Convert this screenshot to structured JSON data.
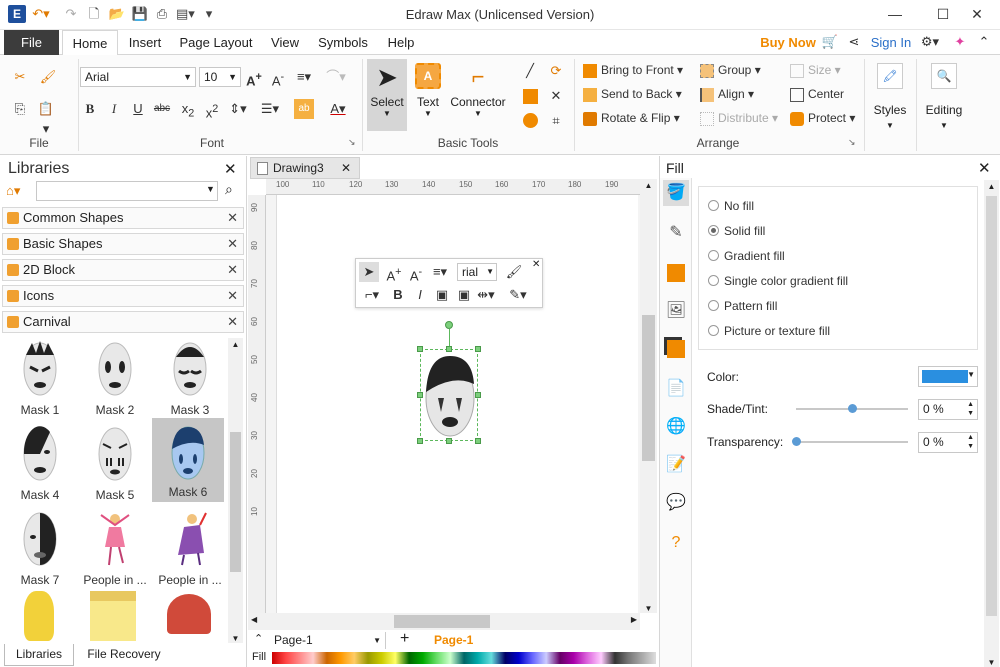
{
  "window": {
    "title": "Edraw Max (Unlicensed Version)"
  },
  "menu": {
    "file": "File",
    "tabs": [
      "Home",
      "Insert",
      "Page Layout",
      "View",
      "Symbols",
      "Help"
    ],
    "buy_now": "Buy Now",
    "sign_in": "Sign In"
  },
  "ribbon": {
    "groups": {
      "file": "File",
      "font": "Font",
      "basic_tools": "Basic Tools",
      "arrange": "Arrange"
    },
    "font_name": "Arial",
    "font_size": "10",
    "tools": {
      "select": "Select",
      "text": "Text",
      "connector": "Connector"
    },
    "arrange": {
      "bring_to_front": "Bring to Front",
      "send_to_back": "Send to Back",
      "rotate_flip": "Rotate & Flip",
      "group": "Group",
      "align": "Align",
      "distribute": "Distribute",
      "size": "Size",
      "center": "Center",
      "protect": "Protect"
    },
    "styles": "Styles",
    "editing": "Editing"
  },
  "libraries": {
    "title": "Libraries",
    "search_placeholder": "",
    "items": [
      "Common Shapes",
      "Basic Shapes",
      "2D Block",
      "Icons",
      "Carnival"
    ],
    "shapes": [
      "Mask 1",
      "Mask 2",
      "Mask 3",
      "Mask 4",
      "Mask 5",
      "Mask 6",
      "Mask 7",
      "People in ...",
      "People in ..."
    ],
    "selected_shape": "Mask 6",
    "bottom_tabs": [
      "Libraries",
      "File Recovery"
    ]
  },
  "document": {
    "tab": "Drawing3",
    "hruler": [
      "100",
      "110",
      "120",
      "130",
      "140",
      "150",
      "160",
      "170",
      "180",
      "190"
    ],
    "vruler": [
      "90",
      "80",
      "70",
      "60",
      "50",
      "40",
      "30",
      "20",
      "10"
    ],
    "page_select": "Page-1",
    "page_tab": "Page-1",
    "fill_label": "Fill"
  },
  "floating_toolbar": {
    "font": "rial"
  },
  "fill_panel": {
    "title": "Fill",
    "options": [
      "No fill",
      "Solid fill",
      "Gradient fill",
      "Single color gradient fill",
      "Pattern fill",
      "Picture or texture fill"
    ],
    "selected": "Solid fill",
    "color_label": "Color:",
    "color": "#2a8fe0",
    "shade_label": "Shade/Tint:",
    "shade_value": "0 %",
    "shade_fraction": 0.5,
    "transparency_label": "Transparency:",
    "transparency_value": "0 %",
    "transparency_fraction": 0.0
  },
  "colors": {
    "accent_orange": "#f08a00",
    "link_blue": "#2a6fc8",
    "selection_green": "#5cb85c"
  }
}
